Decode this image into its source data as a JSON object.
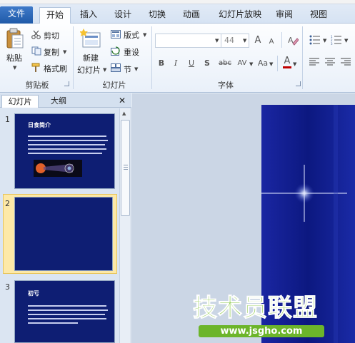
{
  "tabs": [
    "文件",
    "开始",
    "插入",
    "设计",
    "切换",
    "动画",
    "幻灯片放映",
    "审阅",
    "视图"
  ],
  "clipboard": {
    "paste": "粘贴",
    "cut": "剪切",
    "copy": "复制",
    "format_painter": "格式刷",
    "group": "剪贴板"
  },
  "slides_group": {
    "new_slide_line1": "新建",
    "new_slide_line2": "幻灯片",
    "layout": "版式",
    "reset": "重设",
    "section": "节",
    "group": "幻灯片"
  },
  "font_group": {
    "font_size": "44",
    "grow": "A",
    "shrink": "A",
    "bold": "B",
    "italic": "I",
    "underline": "U",
    "shadow": "S",
    "strike": "abc",
    "spacing": "AV",
    "case": "Aa",
    "color": "A",
    "group": "字体"
  },
  "pane": {
    "tab_slides": "幻灯片",
    "tab_outline": "大纲",
    "close": "✕"
  },
  "slides": [
    {
      "num": "1",
      "title": "日食简介"
    },
    {
      "num": "2",
      "title": ""
    },
    {
      "num": "3",
      "title": "初亏"
    }
  ],
  "watermark": {
    "title": "技术员联盟",
    "url": "www.jsgho.com"
  }
}
